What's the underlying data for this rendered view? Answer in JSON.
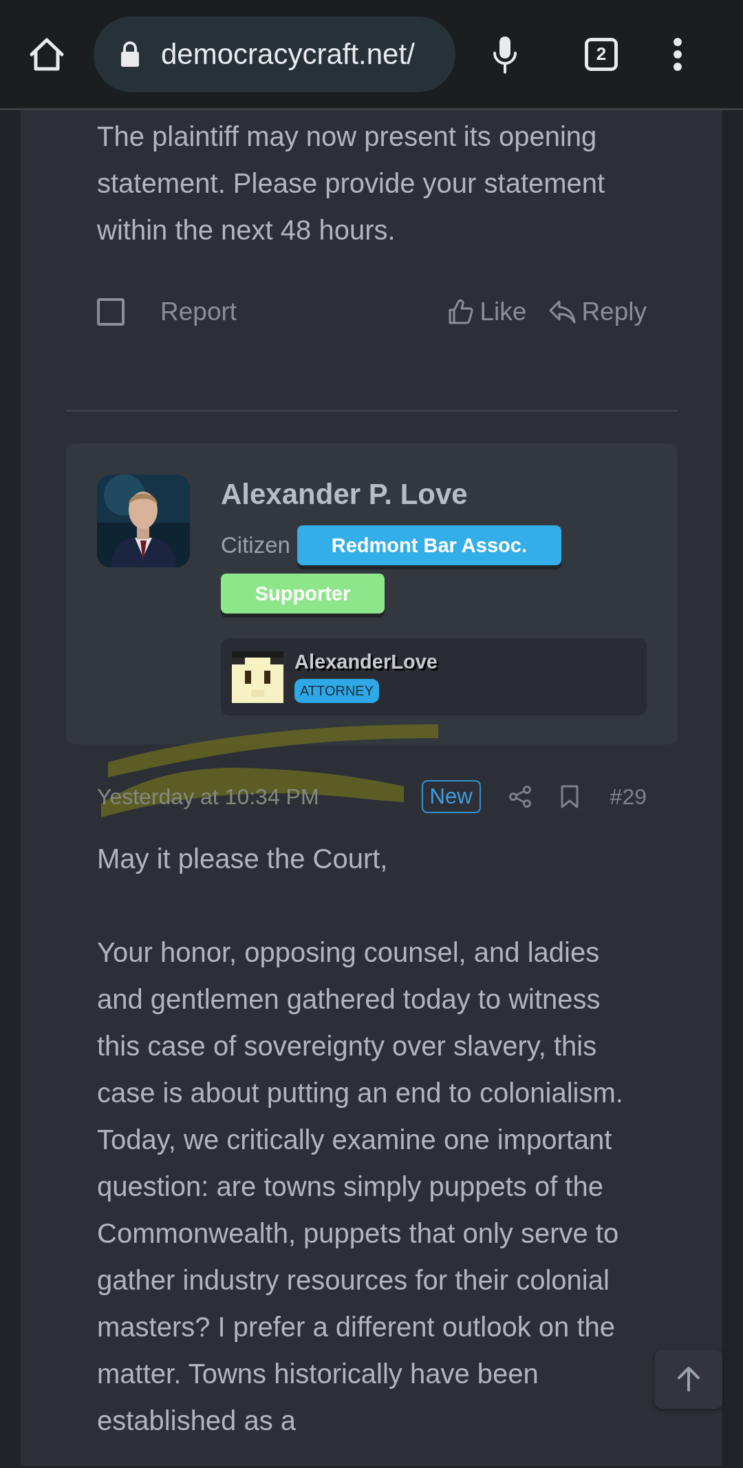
{
  "browser": {
    "url": "democracycraft.net/",
    "tab_count": "2"
  },
  "previous_post": {
    "paragraphs": [
      "The plaintiff may now present its opening statement. Please provide your statement within the next 48 hours."
    ],
    "report": {
      "label": "Report",
      "checked": false
    },
    "actions": [
      {
        "kind": "like",
        "label": "Like"
      },
      {
        "kind": "reply",
        "label": "Reply"
      }
    ]
  },
  "post": {
    "author": {
      "name": "Alexander P. Love",
      "title": "Citizen",
      "banners": [
        {
          "label": "Redmont Bar Assoc.",
          "color": "#33aee9"
        },
        {
          "label": "Supporter",
          "color": "#8ee68a"
        }
      ],
      "game_account": {
        "username": "AlexanderLove",
        "rank": "ATTORNEY"
      }
    },
    "date": "Yesterday at 10:34 PM",
    "badge": "New",
    "number": "#29",
    "paragraphs": [
      "May it please the Court,",
      "Your honor, opposing counsel, and ladies and gentlemen gathered today to witness this case of sovereignty over slavery, this case is about putting an end to colonialism. Today, we critically examine one important question: are towns simply puppets of the Commonwealth, puppets that only serve to gather industry resources for their colonial masters? I prefer a different outlook on the matter. Towns historically have been established as a"
    ]
  }
}
